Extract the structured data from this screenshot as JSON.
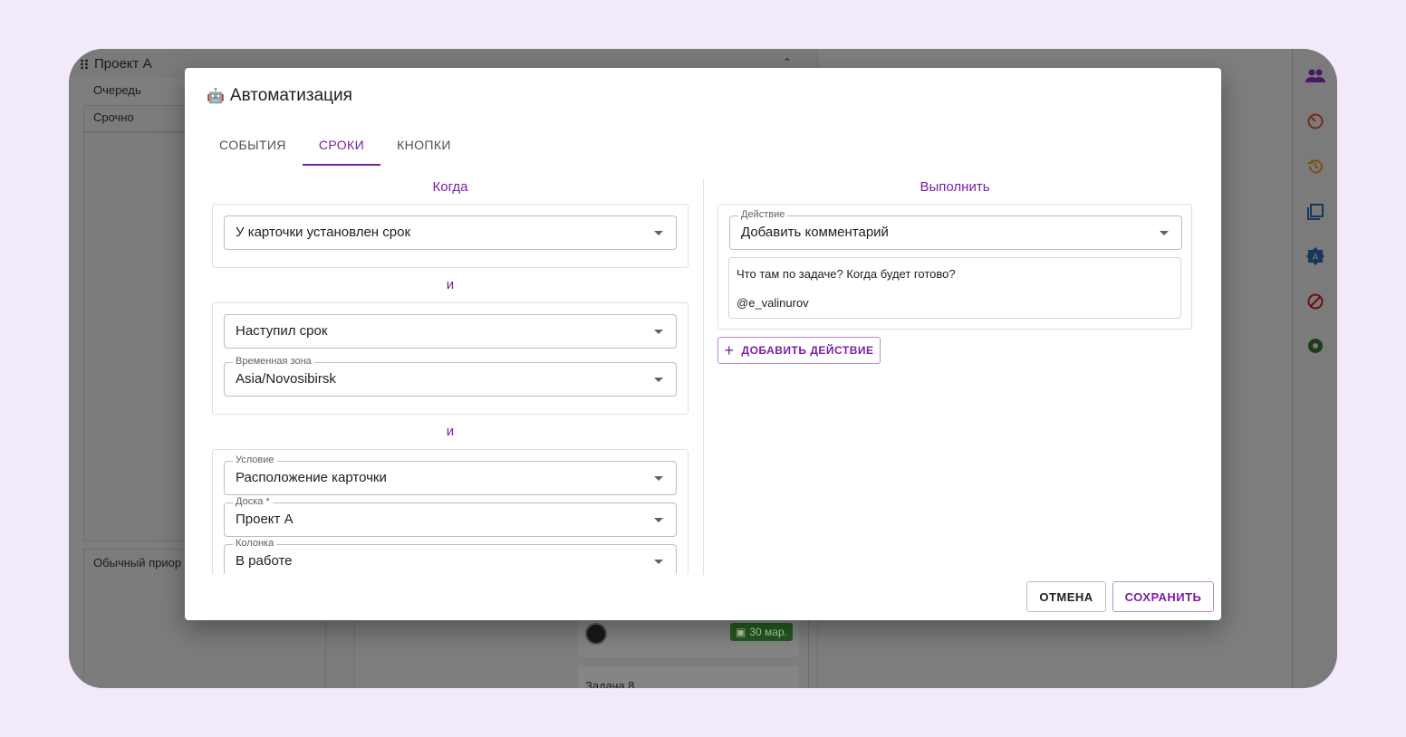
{
  "board": {
    "project_title": "Проект А",
    "columns": [
      "Очередь",
      "Срочно"
    ],
    "lane_normal": "Обычный приор",
    "task_date": "30 мар.",
    "task_next_title": "Задача 8"
  },
  "rail_icons": [
    "people-icon",
    "timer-icon",
    "history-icon",
    "copy-icon",
    "automation-badge-icon",
    "block-icon",
    "aperture-icon"
  ],
  "dialog": {
    "title": "Автоматизация",
    "tabs": [
      "СОБЫТИЯ",
      "СРОКИ",
      "КНОПКИ"
    ],
    "active_tab": "СРОКИ",
    "when_title": "Когда",
    "execute_title": "Выполнить",
    "and_label": "и",
    "trigger": {
      "value": "У карточки установлен срок"
    },
    "deadline": {
      "value": "Наступил срок"
    },
    "timezone": {
      "label": "Временная зона",
      "value": "Asia/Novosibirsk"
    },
    "condition": {
      "label": "Условие",
      "value": "Расположение карточки"
    },
    "board_field": {
      "label": "Доска *",
      "value": "Проект А"
    },
    "column_field": {
      "label": "Колонка",
      "value": "В работе"
    },
    "action": {
      "label": "Действие",
      "value": "Добавить комментарий"
    },
    "comment_lines": [
      "Что там по задаче? Когда будет готово?",
      "",
      "@e_valinurov"
    ],
    "add_action_label": "ДОБАВИТЬ ДЕЙСТВИЕ",
    "cancel_label": "ОТМЕНА",
    "save_label": "СОХРАНИТЬ"
  },
  "colors": {
    "accent": "#7b1fa2",
    "date_chip": "#245a1f",
    "overlay": "#7e7e7e"
  }
}
